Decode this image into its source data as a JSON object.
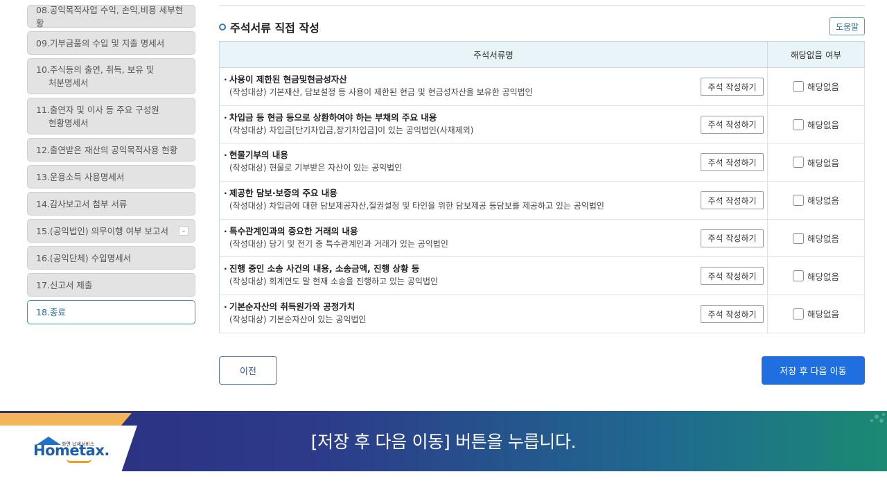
{
  "sidebar": {
    "items": [
      {
        "label": "08.공익목적사업 수익, 손익,비용 세부현황"
      },
      {
        "label": "09.기부금품의 수입 및 지출 명세서"
      },
      {
        "label_line1": "10.주식등의 출연, 취득, 보유 및",
        "label_line2": "처분명세서"
      },
      {
        "label_line1": "11.출연자 및 이사 등 주요 구성원",
        "label_line2": "현황명세서"
      },
      {
        "label": "12.출연받은 재산의 공익목적사용 현황"
      },
      {
        "label": "13.운용소득 사용명세서"
      },
      {
        "label": "14.감사보고서 첨부 서류"
      },
      {
        "label": "15.(공익법인) 의무이행 여부 보고서"
      },
      {
        "label": "16.(공익단체) 수입명세서"
      },
      {
        "label": "17.신고서 제출"
      },
      {
        "label": "18.종료"
      }
    ]
  },
  "section": {
    "title": "주석서류 직접 작성",
    "help_label": "도움말"
  },
  "table": {
    "headers": [
      "주석서류명",
      "해당없음 여부"
    ],
    "rows": [
      {
        "title": "사용이 제한된 현금및현금성자산",
        "sub": "(작성대상) 기본재산, 담보설정 등 사용이 제한된 현금 및 현금성자산을 보유한 공익법인",
        "button": "주석 작성하기",
        "na": "해당없음"
      },
      {
        "title": "차입금 등 현금 등으로 상환하여야 하는 부채의 주요 내용",
        "sub": "(작성대상) 차입금[단기차입금,장기차입금]이 있는 공익법인(사채제외)",
        "button": "주석 작성하기",
        "na": "해당없음"
      },
      {
        "title": "현물기부의 내용",
        "sub": "(작성대상) 현물로 기부받은 자산이 있는 공익법인",
        "button": "주석 작성하기",
        "na": "해당없음"
      },
      {
        "title": "제공한 담보·보증의 주요 내용",
        "sub": "(작성대상) 차입금에 대한 담보제공자산,질권설정 및 타인을 위한 담보제공 등담보를 제공하고 있는 공익법인",
        "button": "주석 작성하기",
        "na": "해당없음"
      },
      {
        "title": "특수관계인과의 중요한 거래의 내용",
        "sub": "(작성대상) 당기 및 전기 중 특수관계인과 거래가 있는 공익법인",
        "button": "주석 작성하기",
        "na": "해당없음"
      },
      {
        "title": "진행 중인 소송 사건의 내용, 소송금액, 진행 상황 등",
        "sub": "(작성대상) 회계연도 말 현재 소송을 진행하고 있는 공익법인",
        "button": "주석 작성하기",
        "na": "해당없음"
      },
      {
        "title": "기본순자산의 취득원가와 공정가치",
        "sub": "(작성대상) 기본순자산이 있는 공익법인",
        "button": "주석 작성하기",
        "na": "해당없음"
      }
    ]
  },
  "footer": {
    "prev_label": "이전",
    "next_label": "저장 후 다음 이동"
  },
  "banner": {
    "logo_small": "화면 납세서비스",
    "logo": "Hometax.",
    "caption": "[저장 후 다음 이동] 버튼을 누릅니다."
  }
}
